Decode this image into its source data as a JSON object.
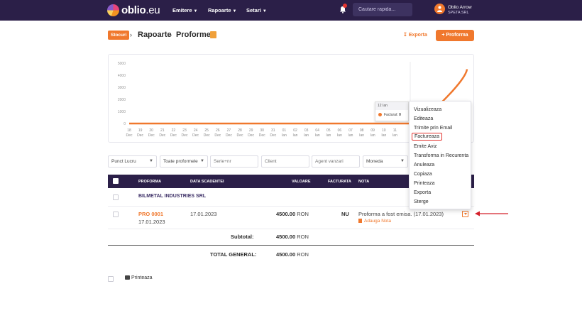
{
  "app": {
    "logo_main": "oblio",
    "logo_suffix": ".eu",
    "colors": {
      "nav_bg": "#2b1f48",
      "accent": "#f0782d",
      "highlight": "#e3342f"
    }
  },
  "nav": {
    "items": [
      {
        "label": "Emitere"
      },
      {
        "label": "Rapoarte"
      },
      {
        "label": "Setari"
      }
    ],
    "notification_count": "",
    "search_placeholder": "Cautare rapida...",
    "user_name": "Oblio Arrow",
    "user_company": "SPETA SRL"
  },
  "breadcrumb": {
    "badge": "Stocuri",
    "items": [
      "Rapoarte",
      "Proforme"
    ]
  },
  "actions": {
    "export_label": "Exporta",
    "add_label": "+ Proforma"
  },
  "chart_data": {
    "type": "line",
    "y_ticks": [
      "5000",
      "4000",
      "3000",
      "2000",
      "1000",
      "0"
    ],
    "ylim": [
      0,
      5000
    ],
    "x_ticks": [
      {
        "day": "18",
        "month": "Dec"
      },
      {
        "day": "19",
        "month": "Dec"
      },
      {
        "day": "20",
        "month": "Dec"
      },
      {
        "day": "21",
        "month": "Dec"
      },
      {
        "day": "22",
        "month": "Dec"
      },
      {
        "day": "23",
        "month": "Dec"
      },
      {
        "day": "24",
        "month": "Dec"
      },
      {
        "day": "25",
        "month": "Dec"
      },
      {
        "day": "26",
        "month": "Dec"
      },
      {
        "day": "27",
        "month": "Dec"
      },
      {
        "day": "28",
        "month": "Dec"
      },
      {
        "day": "29",
        "month": "Dec"
      },
      {
        "day": "30",
        "month": "Dec"
      },
      {
        "day": "31",
        "month": "Dec"
      },
      {
        "day": "01",
        "month": "Ian"
      },
      {
        "day": "02",
        "month": "Ian"
      },
      {
        "day": "03",
        "month": "Ian"
      },
      {
        "day": "04",
        "month": "Ian"
      },
      {
        "day": "05",
        "month": "Ian"
      },
      {
        "day": "06",
        "month": "Ian"
      },
      {
        "day": "07",
        "month": "Ian"
      },
      {
        "day": "08",
        "month": "Ian"
      },
      {
        "day": "09",
        "month": "Ian"
      },
      {
        "day": "10",
        "month": "Ian"
      },
      {
        "day": "11",
        "month": "Ian"
      }
    ],
    "series": [
      {
        "values": [
          0,
          0,
          0,
          0,
          0,
          0,
          0,
          0,
          0,
          0,
          0,
          0,
          0,
          0,
          0,
          0,
          0,
          0,
          0,
          0,
          0,
          0,
          0,
          0,
          0,
          0,
          0,
          4500
        ]
      }
    ],
    "tooltip": {
      "title": "12 Ian",
      "series_name": "Facturat",
      "value": "0"
    },
    "color": "#f0782d"
  },
  "filters": {
    "punct_lucru": "Punct Lucru",
    "status": "Toate proformele",
    "serie_placeholder": "Serie+nr",
    "client_placeholder": "Client",
    "agent_placeholder": "Agent vanzari",
    "moneda": "Moneda"
  },
  "table": {
    "headers": {
      "proforma": "PROFORMA",
      "data": "DATA SCADENTEI",
      "valoare": "VALOARE",
      "facturata": "FACTURATA",
      "nota": "NOTA"
    },
    "group": "BILMETAL INDUSTRIES SRL",
    "row": {
      "number": "PRO 0001",
      "issue_date": "17.01.2023",
      "due_date": "17.01.2023",
      "amount": "4500.00",
      "currency": "RON",
      "invoiced": "NU",
      "note": "Proforma a fost emisa. (17.01.2023)",
      "add_note": "Adauga Nota"
    },
    "subtotal_label": "Subtotal:",
    "subtotal_amount": "4500.00",
    "subtotal_currency": "RON",
    "total_label": "TOTAL GENERAL:",
    "total_amount": "4500.00",
    "total_currency": "RON"
  },
  "context_menu": {
    "items": [
      "Vizualizeaza",
      "Editeaza",
      "Trimite prin Email",
      "Factureaza",
      "Emite Aviz",
      "Transforma in Recurenta",
      "Anuleaza",
      "Copiaza",
      "Printeaza",
      "Exporta",
      "Sterge"
    ],
    "highlighted_index": 3
  },
  "footer": {
    "print_label": "Printeaza"
  }
}
